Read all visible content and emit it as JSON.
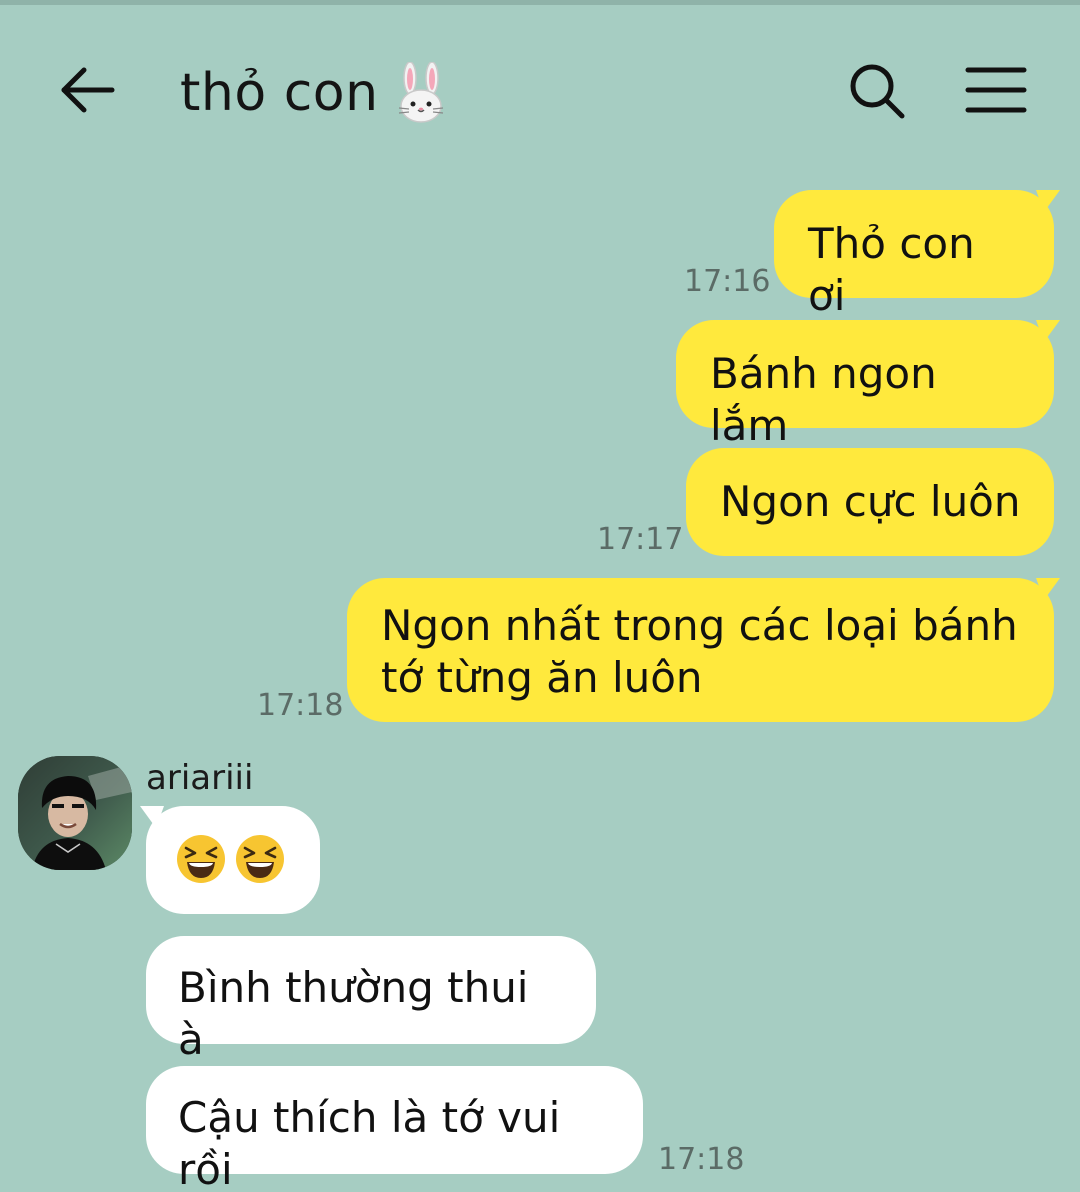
{
  "header": {
    "title": "thỏ con",
    "title_icon": "rabbit-face-icon",
    "back_icon": "arrow-left-icon",
    "search_icon": "search-icon",
    "menu_icon": "hamburger-menu-icon"
  },
  "messages": {
    "out": [
      {
        "text": "Thỏ con ơi",
        "time": "17:16"
      },
      {
        "text": "Bánh ngon lắm",
        "time": ""
      },
      {
        "text": "Ngon cực luôn",
        "time": "17:17"
      },
      {
        "text_line1": "Ngon nhất trong các loại bánh",
        "text_line2": "tớ từng ăn luôn",
        "time": "17:18"
      }
    ],
    "in": {
      "sender": "ariariii",
      "emoji_message": [
        "laughing-face-emoji",
        "laughing-face-emoji"
      ],
      "items": [
        {
          "text": "Bình thường thui à"
        },
        {
          "text": "Cậu thích là tớ vui rồi",
          "time": "17:18"
        }
      ]
    }
  },
  "colors": {
    "background": "#a6cdc2",
    "outgoing_bubble": "#ffe93d",
    "incoming_bubble": "#ffffff",
    "timestamp": "#5b6b66"
  }
}
